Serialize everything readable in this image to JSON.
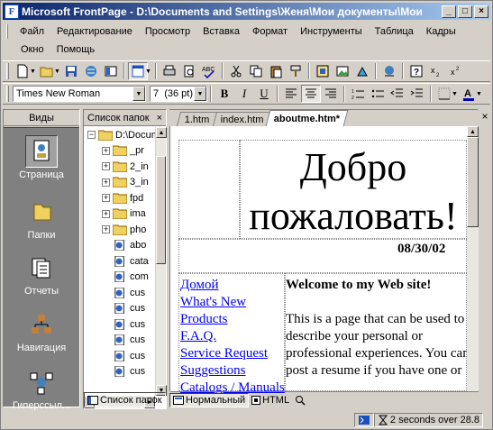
{
  "window": {
    "title": "Microsoft FrontPage - D:\\Documents and Settings\\Женя\\Мои документы\\Мои"
  },
  "menu": {
    "row1": [
      "Файл",
      "Редактирование",
      "Просмотр",
      "Вставка",
      "Формат",
      "Инструменты",
      "Таблица",
      "Кадры"
    ],
    "row2": [
      "Окно",
      "Помощь"
    ]
  },
  "format_toolbar": {
    "font": "Times New Roman",
    "size": "7  (36 pt)"
  },
  "views": {
    "header": "Виды",
    "items": [
      "Страница",
      "Папки",
      "Отчеты",
      "Навигация",
      "Гиперссыл..."
    ]
  },
  "folders": {
    "header": "Список папок",
    "root": "D:\\Documents",
    "items": [
      "_pr",
      "2_in",
      "3_in",
      "fpd",
      "ima",
      "pho",
      "abo",
      "cata",
      "com",
      "cus",
      "cus",
      "cus",
      "cus",
      "cus",
      "cus"
    ],
    "bottom_tab": "Список папок"
  },
  "editor": {
    "tabs": [
      "1.htm",
      "index.htm",
      "aboutme.htm*"
    ],
    "heading": "Добро пожаловать!",
    "date": "08/30/02",
    "links": [
      "Домой",
      "What's New",
      "Products",
      "F.A.Q.",
      "Service Request",
      "Suggestions",
      "Catalogs / Manuals"
    ],
    "welcome_title": "Welcome to my Web site!",
    "welcome_body": "This is a page that can be used to describe your personal or professional experiences.  You can post a resume if you have one or you can just talk about"
  },
  "bottom_tabs": [
    "Нормальный",
    "HTML"
  ],
  "status": {
    "time": "2 seconds over 28.8"
  }
}
